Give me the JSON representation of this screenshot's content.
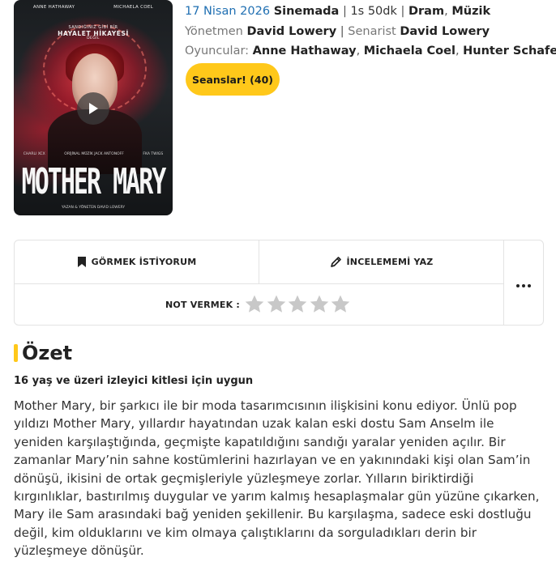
{
  "poster": {
    "cast_top": [
      "ANNE HATHAWAY",
      "MICHAELA COEL"
    ],
    "tagline": [
      "SANDIĞINIZ GİBİ BİR",
      "HAYALET HİKAYESİ",
      "DEĞİL"
    ],
    "credits_mid": [
      "CHARLI XCX",
      "ORİJİNAL MÜZİK JACK ANTONOFF",
      "FKA TWIGS"
    ],
    "title": "MOTHER MARY",
    "credits_bottom": "YAZAN & YÖNETEN DAVID LOWERY"
  },
  "info": {
    "date": "17 Nisan 2026",
    "venue": "Sinemada",
    "duration": "1s 50dk",
    "genres": [
      "Dram",
      "Müzik"
    ],
    "director_label": "Yönetmen",
    "director": "David Lowery",
    "writer_label": "Senarist",
    "writer": "David Lowery",
    "cast_label": "Oyuncular:",
    "cast": [
      "Anne Hathaway",
      "Michaela Coel",
      "Hunter Schafer"
    ]
  },
  "showtimes_button": "Seanslar! (40)",
  "actions": {
    "want_label": "GÖRMEK İSTİYORUM",
    "review_label": "İNCELEMEMİ YAZ",
    "rate_label": "NOT VERMEK :",
    "stars_total": 5,
    "stars_filled": 0
  },
  "summary": {
    "heading": "Özet",
    "age_note": "16 yaş ve üzeri izleyici kitlesi için uygun",
    "text": "Mother Mary, bir şarkıcı ile bir moda tasarımcısının ilişkisini konu ediyor. Ünlü pop yıldızı Mother Mary, yıllardır hayatından uzak kalan eski dostu Sam Anselm ile yeniden karşılaştığında, geçmişte kapatıldığını sandığı yaralar yeniden açılır. Bir zamanlar Mary’nin sahne kostümlerini hazırlayan ve en yakınındaki kişi olan Sam’in dönüşü, ikisini de ortak geçmişleriyle yüzleşmeye zorlar. Yılların biriktirdiği kırgınlıklar, bastırılmış duygular ve yarım kalmış hesaplaşmalar gün yüzüne çıkarken, Mary ile Sam arasındaki bağ yeniden şekillenir. Bu karşılaşma, sadece eski dostluğu değil, kim olduklarını ve kim olmaya çalıştıklarını da sorguladıkları derin bir yüzleşmeye dönüşür."
  },
  "colors": {
    "accent": "#ffc81a",
    "date_link": "#1f6fb2",
    "star_empty": "#c8c8c8"
  }
}
